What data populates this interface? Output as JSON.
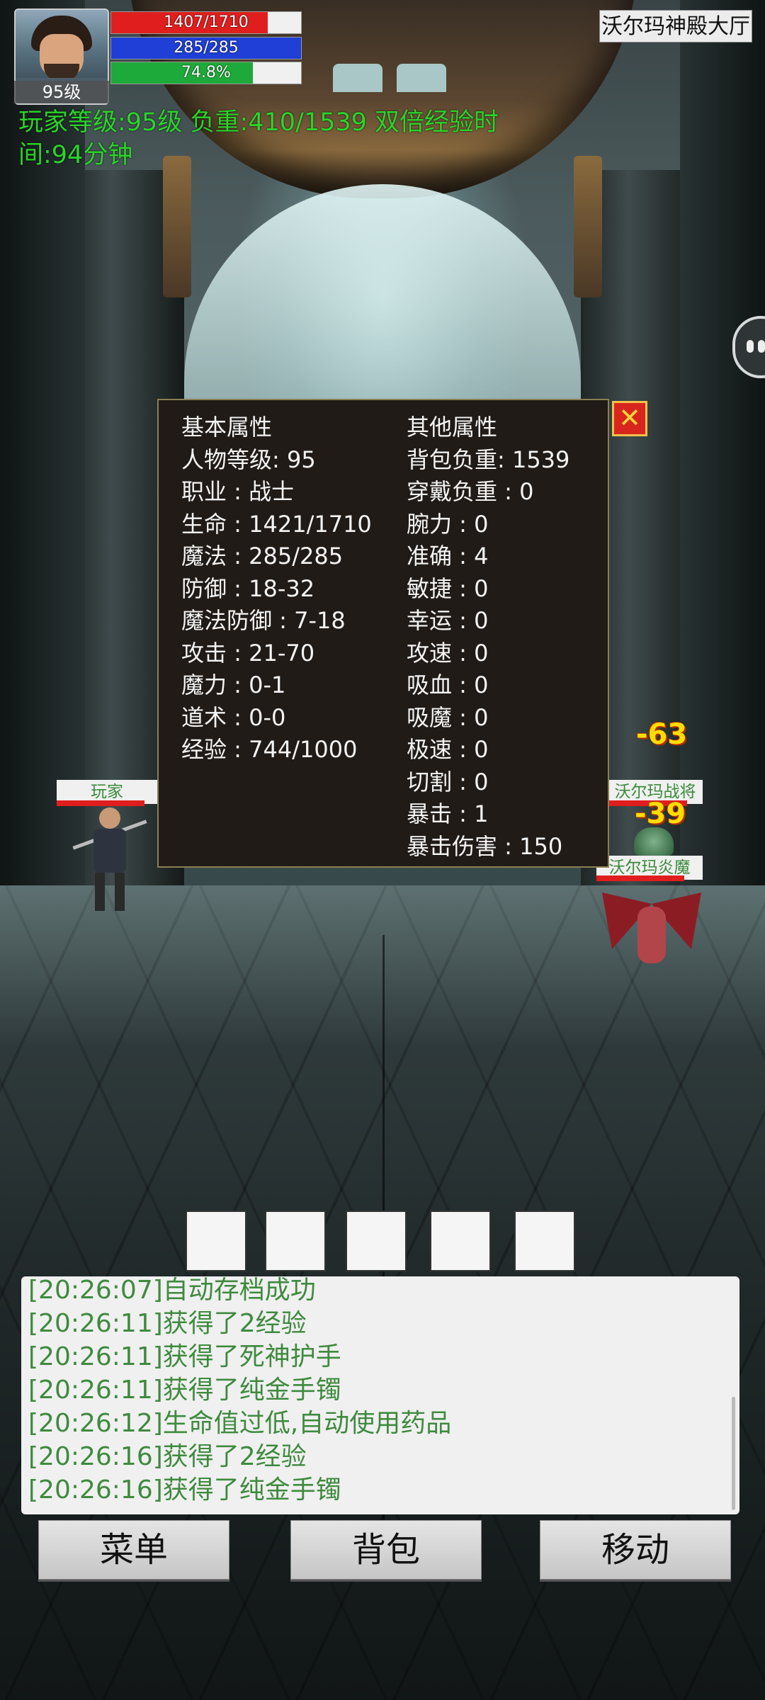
{
  "hud": {
    "avatar_level": "95级",
    "hp_text": "1407/1710",
    "hp_fraction": 0.823,
    "mp_text": "285/285",
    "mp_fraction": 1.0,
    "xp_text": "74.8%",
    "xp_fraction": 0.748,
    "status_line": "玩家等级:95级 负重:410/1539 双倍经验时间:94分钟"
  },
  "map_name": "沃尔玛神殿大厅",
  "characters": {
    "player_name": "玩家",
    "enemy1_name": "沃尔玛战将",
    "enemy2_name": "沃尔玛炎魔",
    "damage1": "-63",
    "damage2": "-39"
  },
  "panel": {
    "left": [
      "基本属性",
      "人物等级: 95",
      "职业 : 战士",
      "生命 : 1421/1710",
      "魔法 : 285/285",
      "防御 : 18-32",
      "魔法防御 : 7-18",
      "攻击 : 21-70",
      "魔力 : 0-1",
      "道术 : 0-0",
      "经验 : 744/1000"
    ],
    "right": [
      "其他属性",
      "背包负重: 1539",
      "穿戴负重 : 0",
      "腕力 : 0",
      "准确 : 4",
      "敏捷 : 0",
      "幸运 : 0",
      "攻速 : 0",
      "吸血 : 0",
      "吸魔 : 0",
      "极速 : 0",
      "切割 : 0",
      "暴击 : 1",
      "暴击伤害 : 150"
    ],
    "close_icon": "close-x"
  },
  "log": [
    "[20:26:07]自动存档成功",
    "[20:26:11]获得了2经验",
    "[20:26:11]获得了死神护手",
    "[20:26:11]获得了纯金手镯",
    "[20:26:12]生命值过低,自动使用药品",
    "[20:26:16]获得了2经验",
    "[20:26:16]获得了纯金手镯"
  ],
  "buttons": {
    "menu": "菜单",
    "bag": "背包",
    "move": "移动"
  }
}
